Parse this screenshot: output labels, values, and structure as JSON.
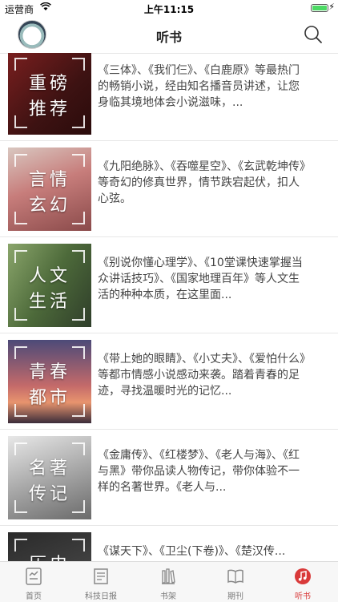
{
  "status": {
    "carrier": "运营商",
    "time": "上午11:15"
  },
  "nav": {
    "title": "听书"
  },
  "items": [
    {
      "t1": "重磅",
      "t2": "推荐",
      "desc": "《三体》、《我们仨》、《白鹿原》等最热门的畅销小说，经由知名播音员讲述，让您身临其境地体会小说滋味，..."
    },
    {
      "t1": "言情",
      "t2": "玄幻",
      "desc": "《九阳绝脉》、《吞噬星空》、《玄武乾坤传》等奇幻的修真世界，情节跌宕起伏，扣人心弦。"
    },
    {
      "t1": "人文",
      "t2": "生活",
      "desc": "《别说你懂心理学》、《10堂课快速掌握当众讲话技巧》、《国家地理百年》等人文生活的种种本质，在这里面..."
    },
    {
      "t1": "青春",
      "t2": "都市",
      "desc": "《带上她的眼睛》、《小丈夫》、《爱怕什么》等都市情感小说感动来袭。踏着青春的足迹，寻找温暖时光的记忆..."
    },
    {
      "t1": "名著",
      "t2": "传记",
      "desc": "《金庸传》、《红楼梦》、《老人与海》、《红与黑》带你品读人物传记，带你体验不一样的名著世界。《老人与..."
    },
    {
      "t1": "历史",
      "t2": "",
      "desc": "《谋天下》、《卫尘(下卷)》、《楚汉传..."
    }
  ],
  "tabs": [
    {
      "label": "首页",
      "icon": "home-icon"
    },
    {
      "label": "科技日报",
      "icon": "newspaper-icon"
    },
    {
      "label": "书架",
      "icon": "bookshelf-icon"
    },
    {
      "label": "期刊",
      "icon": "book-icon"
    },
    {
      "label": "听书",
      "icon": "music-note-icon",
      "active": true
    }
  ],
  "colors": {
    "accent": "#d93a3a"
  }
}
